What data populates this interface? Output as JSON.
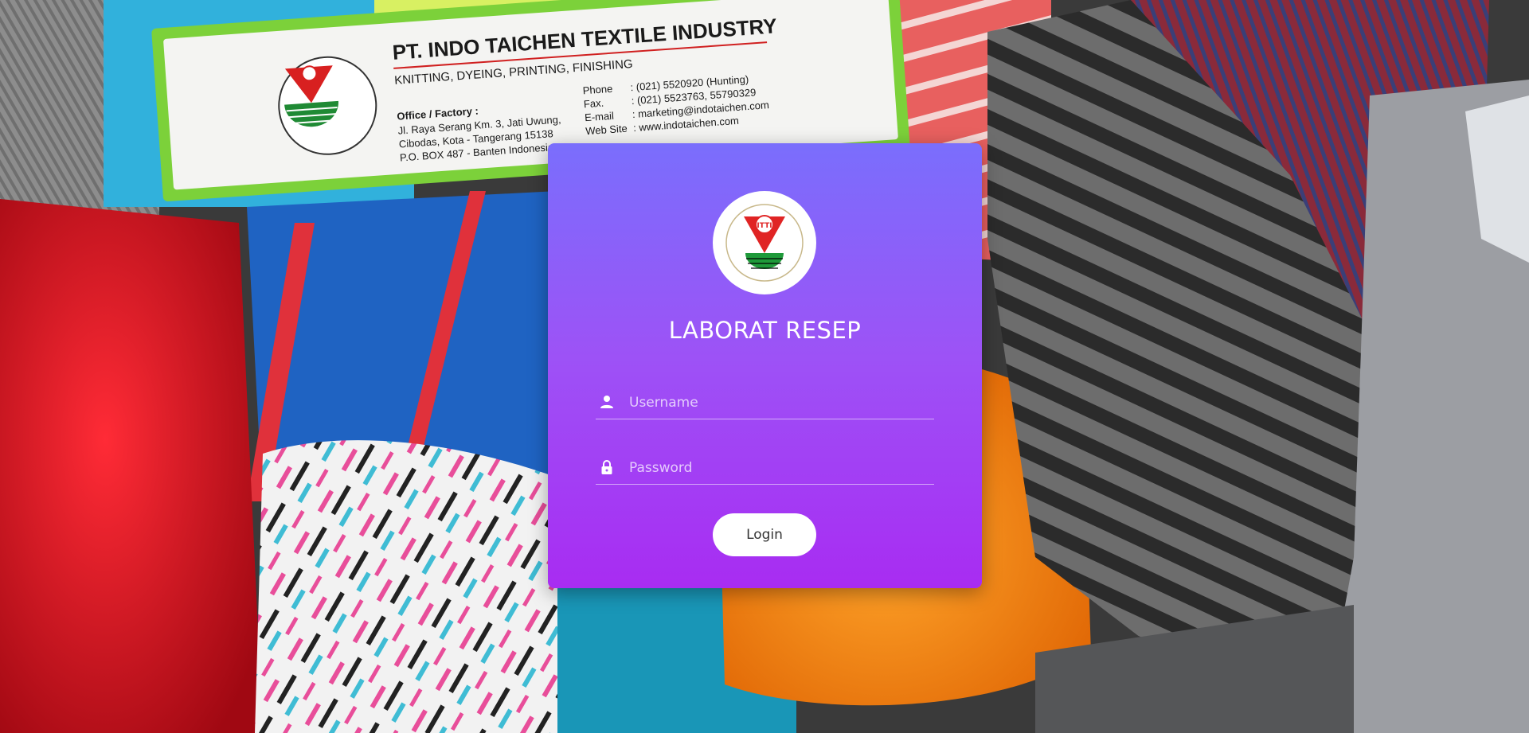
{
  "background": {
    "banner": {
      "company": "PT. INDO TAICHEN TEXTILE INDUSTRY",
      "services": "KNITTING, DYEING, PRINTING, FINISHING",
      "office_label": "Office / Factory :",
      "address_1": "Jl. Raya Serang Km. 3, Jati Uwung,",
      "address_2": "Cibodas, Kota - Tangerang 15138",
      "address_3": "P.O. BOX 487 - Banten Indonesia",
      "phone_label": "Phone",
      "phone_value": ": (021) 5520920 (Hunting)",
      "fax_label": "Fax.",
      "fax_value": ": (021) 5523763, 55790329",
      "email_label": "E-mail",
      "email_value": ": marketing@indotaichen.com",
      "web_label": "Web Site",
      "web_value": ": www.indotaichen.com",
      "logo_text": "ITTI"
    }
  },
  "login": {
    "logo_text": "ITTI",
    "title": "LABORAT RESEP",
    "username_placeholder": "Username",
    "password_placeholder": "Password",
    "button_label": "Login",
    "icons": {
      "username": "user-icon",
      "password": "lock-icon"
    }
  },
  "colors": {
    "card_top": "#7a6efc",
    "card_bottom": "#a82cf2",
    "logo_red": "#e02424",
    "logo_green": "#1f9a3a"
  }
}
